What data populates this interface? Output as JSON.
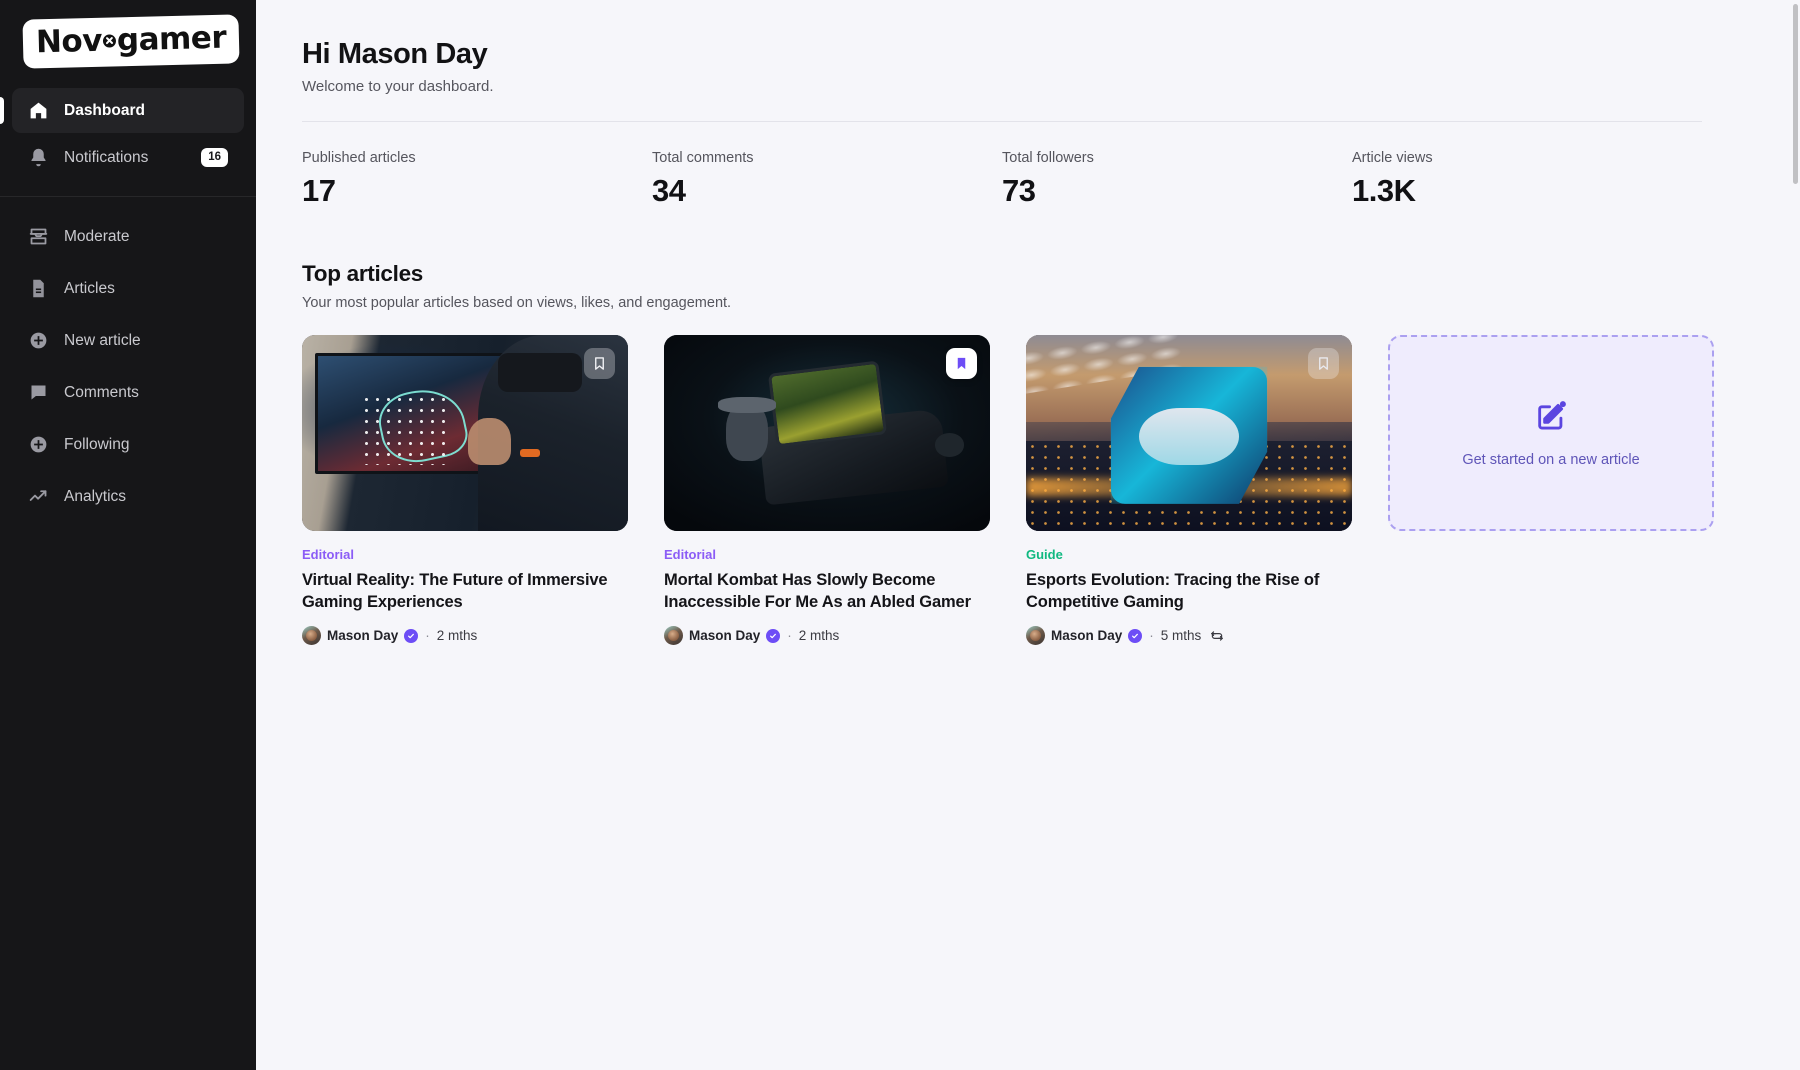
{
  "sidebar": {
    "logo": {
      "before": "Nov",
      "after": "gamer"
    },
    "primary": [
      {
        "label": "Dashboard",
        "icon": "home-icon",
        "active": true
      },
      {
        "label": "Notifications",
        "icon": "bell-icon",
        "badge": "16",
        "active": false
      }
    ],
    "secondary": [
      {
        "label": "Moderate",
        "icon": "inbox-icon"
      },
      {
        "label": "Articles",
        "icon": "document-icon"
      },
      {
        "label": "New article",
        "icon": "plus-circle-icon"
      },
      {
        "label": "Comments",
        "icon": "comment-icon"
      },
      {
        "label": "Following",
        "icon": "plus-circle-icon"
      },
      {
        "label": "Analytics",
        "icon": "trending-up-icon"
      }
    ]
  },
  "header": {
    "title": "Hi Mason Day",
    "subtitle": "Welcome to your dashboard."
  },
  "stats": [
    {
      "label": "Published articles",
      "value": "17"
    },
    {
      "label": "Total comments",
      "value": "34"
    },
    {
      "label": "Total followers",
      "value": "73"
    },
    {
      "label": "Article views",
      "value": "1.3K"
    }
  ],
  "top_articles": {
    "title": "Top articles",
    "subtitle": "Your most popular articles based on views, likes, and engagement.",
    "cards": [
      {
        "category": "Editorial",
        "category_color": "#8b5cf6",
        "title": "Virtual Reality: The Future of Immersive Gaming Experiences",
        "author": "Mason Day",
        "separator": "·",
        "time": "2 mths",
        "bookmarked": false,
        "updated": false,
        "image_alt": "person wearing vr headset in front of a large screen"
      },
      {
        "category": "Editorial",
        "category_color": "#8b5cf6",
        "title": "Mortal Kombat Has Slowly Become Inaccessible For Me As an Abled Gamer",
        "author": "Mason Day",
        "separator": "·",
        "time": "2 mths",
        "bookmarked": true,
        "updated": false,
        "image_alt": "smartphone running a battle royale game next to a toy gun"
      },
      {
        "category": "Guide",
        "category_color": "#10b981",
        "title": "Esports Evolution: Tracing the Rise of Competitive Gaming",
        "author": "Mason Day",
        "separator": "·",
        "time": "5 mths",
        "bookmarked": false,
        "updated": true,
        "image_alt": "glowing cyan geometric logo over a night city skyline"
      }
    ],
    "cta": {
      "label": "Get started on a new article",
      "icon": "edit-pencil-icon",
      "accent": "#5b45e0"
    }
  }
}
